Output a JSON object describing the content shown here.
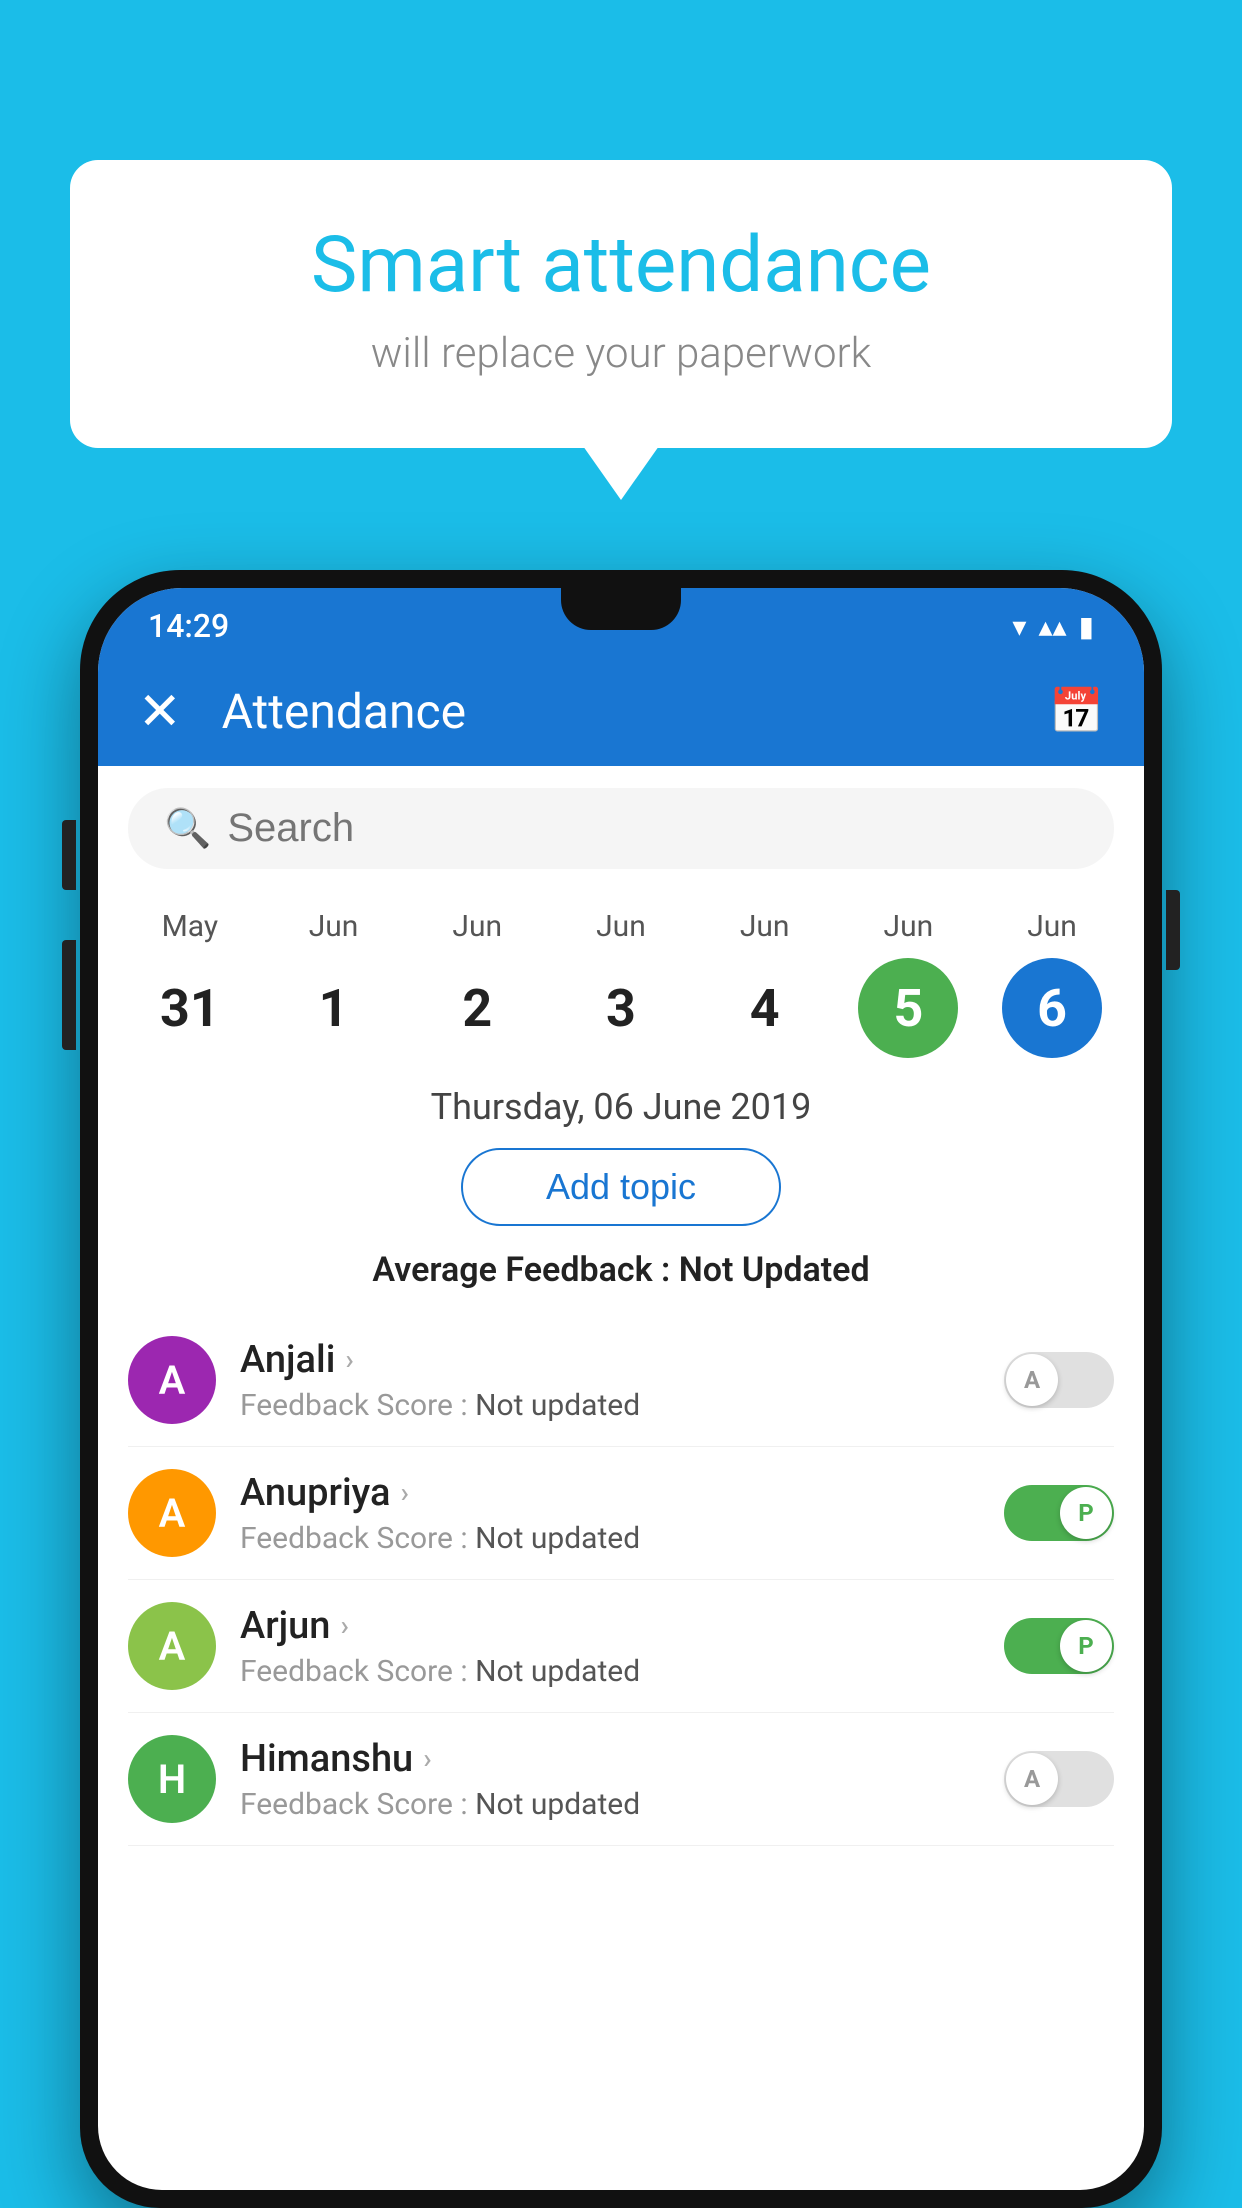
{
  "background_color": "#1BBDE8",
  "speech_bubble": {
    "title": "Smart attendance",
    "subtitle": "will replace your paperwork"
  },
  "status_bar": {
    "time": "14:29",
    "wifi": "▾",
    "signal": "◂",
    "battery": "▮"
  },
  "app_bar": {
    "title": "Attendance",
    "close_label": "×",
    "calendar_icon": "📅"
  },
  "search": {
    "placeholder": "Search"
  },
  "dates": [
    {
      "month": "May",
      "day": "31",
      "active": ""
    },
    {
      "month": "Jun",
      "day": "1",
      "active": ""
    },
    {
      "month": "Jun",
      "day": "2",
      "active": ""
    },
    {
      "month": "Jun",
      "day": "3",
      "active": ""
    },
    {
      "month": "Jun",
      "day": "4",
      "active": ""
    },
    {
      "month": "Jun",
      "day": "5",
      "active": "green"
    },
    {
      "month": "Jun",
      "day": "6",
      "active": "blue"
    }
  ],
  "selected_date": "Thursday, 06 June 2019",
  "add_topic_label": "Add topic",
  "avg_feedback": {
    "label": "Average Feedback : ",
    "value": "Not Updated"
  },
  "students": [
    {
      "name": "Anjali",
      "avatar_letter": "A",
      "avatar_color": "purple",
      "feedback": "Feedback Score : ",
      "feedback_value": "Not updated",
      "toggle": "off",
      "toggle_letter": "A"
    },
    {
      "name": "Anupriya",
      "avatar_letter": "A",
      "avatar_color": "orange",
      "feedback": "Feedback Score : ",
      "feedback_value": "Not updated",
      "toggle": "on",
      "toggle_letter": "P"
    },
    {
      "name": "Arjun",
      "avatar_letter": "A",
      "avatar_color": "light-green",
      "feedback": "Feedback Score : ",
      "feedback_value": "Not updated",
      "toggle": "on",
      "toggle_letter": "P"
    },
    {
      "name": "Himanshu",
      "avatar_letter": "H",
      "avatar_color": "teal",
      "feedback": "Feedback Score : ",
      "feedback_value": "Not updated",
      "toggle": "off",
      "toggle_letter": "A"
    }
  ]
}
